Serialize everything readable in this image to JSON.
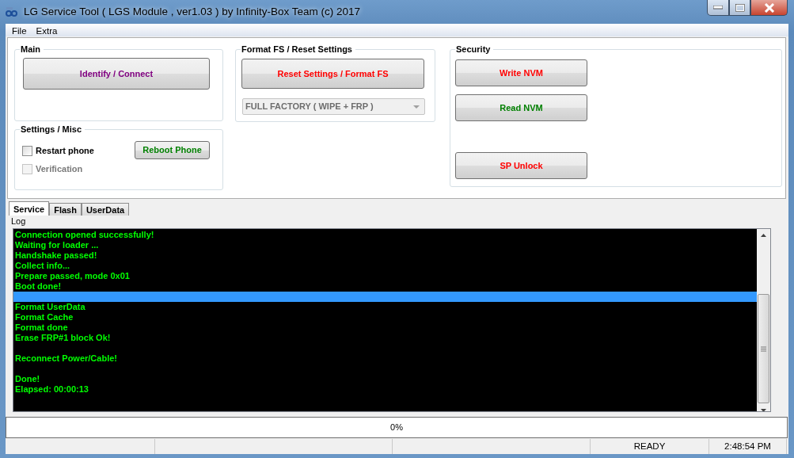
{
  "window": {
    "title": "LG Service Tool ( LGS Module , ver1.03  ) by Infinity-Box Team (c) 2017"
  },
  "menu": [
    "File",
    "Extra"
  ],
  "groups": [
    {
      "title": "Main",
      "buttons": [
        {
          "label": "Identify / Connect",
          "color": "#800080"
        }
      ]
    },
    {
      "title": "Settings / Misc",
      "checkboxes": [
        {
          "label": "Restart phone",
          "checked": false,
          "disabled": false
        },
        {
          "label": "Verification",
          "checked": false,
          "disabled": true
        }
      ],
      "buttons": [
        {
          "label": "Reboot Phone",
          "color": "#008000"
        }
      ]
    },
    {
      "title": "Format FS / Reset Settings",
      "buttons": [
        {
          "label": "Reset Settings / Format FS",
          "color": "#ff0000"
        }
      ],
      "dropdown": {
        "value": "FULL FACTORY ( WIPE + FRP )",
        "disabled": true
      }
    },
    {
      "title": "Security",
      "buttons": [
        {
          "label": "Write NVM",
          "color": "#ff0000"
        },
        {
          "label": "Read NVM",
          "color": "#008000"
        },
        {
          "label": "SP Unlock",
          "color": "#ff0000"
        }
      ]
    }
  ],
  "tabs": [
    {
      "label": "Service",
      "selected": true
    },
    {
      "label": "Flash",
      "selected": false
    },
    {
      "label": "UserData",
      "selected": false
    }
  ],
  "log": {
    "label": "Log",
    "lines": [
      {
        "kind": "text",
        "text": "Connection opened successfully!",
        "selected": false
      },
      {
        "kind": "text",
        "text": "Waiting for loader ...",
        "selected": false
      },
      {
        "kind": "text",
        "text": "Handshake passed!",
        "selected": false
      },
      {
        "kind": "text",
        "text": "Collect info...",
        "selected": false
      },
      {
        "kind": "text",
        "text": "Prepare passed, mode 0x01",
        "selected": false
      },
      {
        "kind": "text",
        "text": "Boot done!",
        "selected": false
      },
      {
        "kind": "blank",
        "selected": true
      },
      {
        "kind": "text",
        "text": "Format UserData",
        "selected": false
      },
      {
        "kind": "text",
        "text": "Format Cache",
        "selected": false
      },
      {
        "kind": "text",
        "text": "Format done",
        "selected": false
      },
      {
        "kind": "text",
        "text": "Erase FRP#1 block Ok!",
        "selected": false
      },
      {
        "kind": "blank",
        "selected": false
      },
      {
        "kind": "text",
        "text": "Reconnect Power/Cable!",
        "selected": false
      },
      {
        "kind": "blank",
        "selected": false
      },
      {
        "kind": "text",
        "text": "Done!",
        "selected": false
      },
      {
        "kind": "text",
        "text": "Elapsed: 00:00:13",
        "selected": false
      }
    ]
  },
  "progress": {
    "level": 0,
    "text": "0%"
  },
  "status_bar": {
    "state": "READY",
    "time": "2:48:54 PM"
  }
}
